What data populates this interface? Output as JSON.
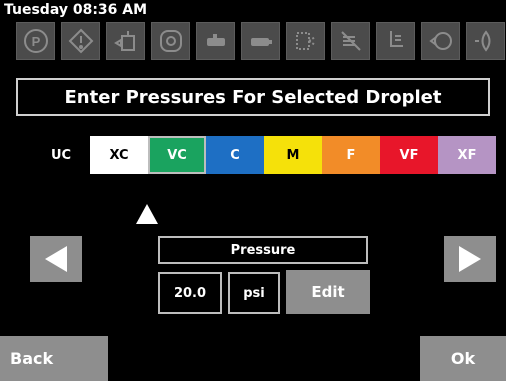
{
  "status": {
    "datetime": "Tuesday 08:36 AM"
  },
  "toolbar_icons": [
    "parking-icon",
    "warning-icon",
    "nozzle-tank-icon",
    "boom-section-icon",
    "nozzle-icon",
    "spray-nozzle-icon",
    "spray-pattern-icon",
    "no-spray-icon",
    "hand-pressure-icon",
    "flow-valve-icon",
    "spray-drop-icon"
  ],
  "title": "Enter Pressures For Selected Droplet",
  "droplets": [
    {
      "label": "UC",
      "bg": "#000000",
      "fg": "#ffffff"
    },
    {
      "label": "XC",
      "bg": "#ffffff",
      "fg": "#000000"
    },
    {
      "label": "VC",
      "bg": "#1aa35f",
      "fg": "#ffffff",
      "selected": true
    },
    {
      "label": "C",
      "bg": "#1e6fc4",
      "fg": "#ffffff"
    },
    {
      "label": "M",
      "bg": "#f5e10a",
      "fg": "#000000"
    },
    {
      "label": "F",
      "bg": "#f28c28",
      "fg": "#ffffff"
    },
    {
      "label": "VF",
      "bg": "#e8162a",
      "fg": "#ffffff"
    },
    {
      "label": "XF",
      "bg": "#b594c4",
      "fg": "#ffffff"
    }
  ],
  "pressure": {
    "label": "Pressure",
    "value": "20.0",
    "unit": "psi",
    "edit_label": "Edit"
  },
  "footer": {
    "back_label": "Back",
    "ok_label": "Ok"
  }
}
